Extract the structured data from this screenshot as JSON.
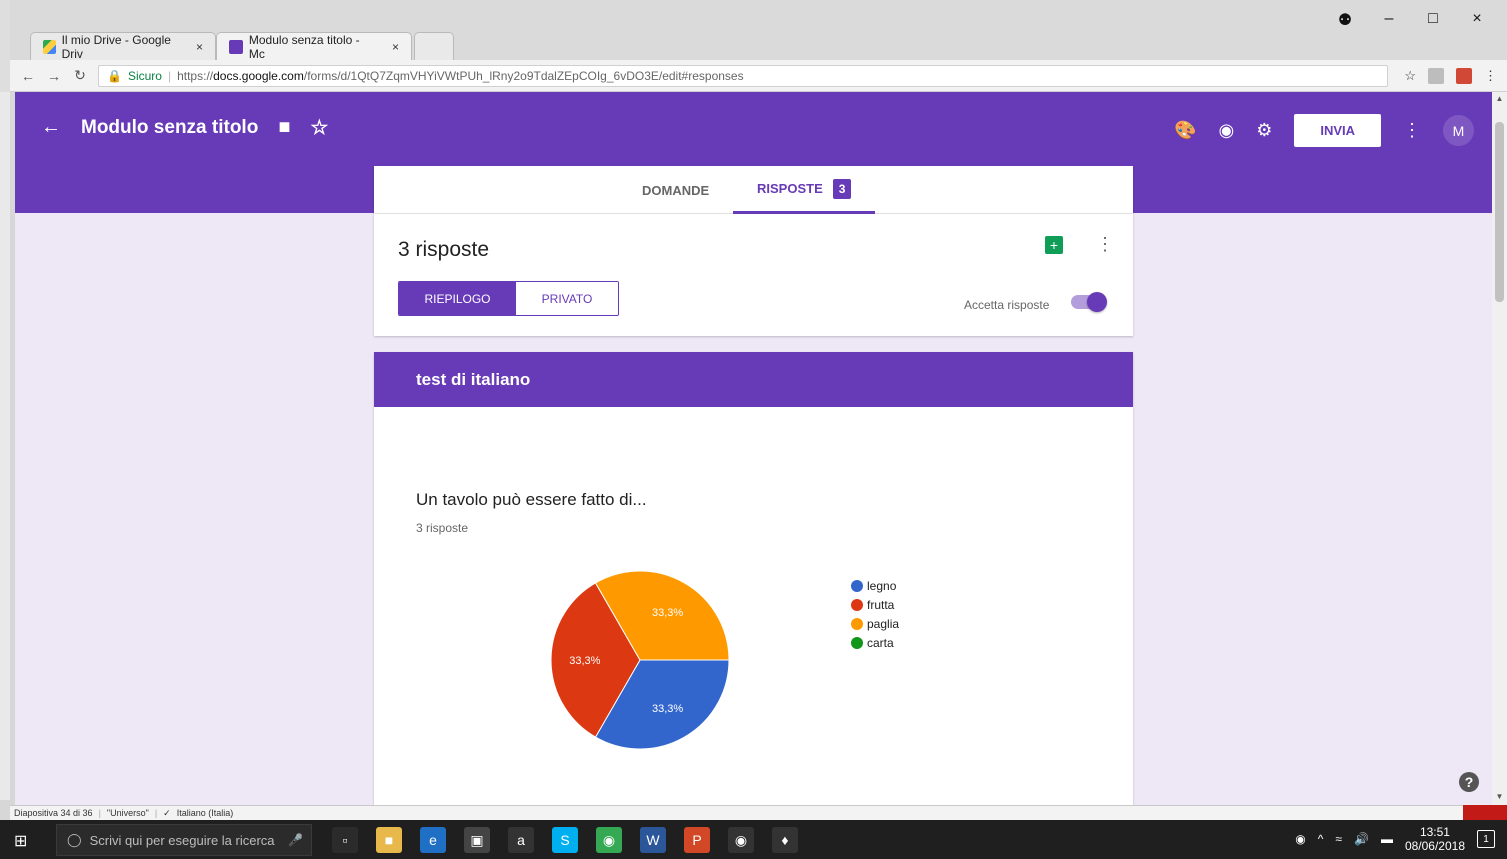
{
  "browser": {
    "tabs": [
      {
        "label": "Il mio Drive - Google Driv",
        "close": "×"
      },
      {
        "label": "Modulo senza titolo - Mc",
        "close": "×"
      }
    ],
    "window_controls": {
      "minimize": "–",
      "maximize": "□",
      "close": "×"
    },
    "omnibox": {
      "secure_label": "Sicuro",
      "url_prefix": "https://",
      "url_host": "docs.google.com",
      "url_path": "/forms/d/1QtQ7ZqmVHYiVWtPUh_lRny2o9TdalZEpCOIg_6vDO3E/edit#responses"
    }
  },
  "header": {
    "title": "Modulo senza titolo",
    "send_label": "INVIA",
    "avatar_initial": "M",
    "colors": {
      "brand": "#673ab7"
    }
  },
  "tabs": {
    "questions_label": "DOMANDE",
    "responses_label": "RISPOSTE",
    "responses_count": "3"
  },
  "responses": {
    "title": "3 risposte",
    "summary_label": "RIEPILOGO",
    "individual_label": "PRIVATO",
    "accept_label": "Accetta risposte",
    "accepting": true
  },
  "section": {
    "title": "test di italiano"
  },
  "question": {
    "title": "Un tavolo può essere fatto di...",
    "count_label": "3 risposte"
  },
  "chart_data": {
    "type": "pie",
    "title": "",
    "slices": [
      {
        "label": "legno",
        "value": 33.3,
        "color": "#3366cc"
      },
      {
        "label": "frutta",
        "value": 33.3,
        "color": "#dc3912"
      },
      {
        "label": "paglia",
        "value": 33.3,
        "color": "#ff9900"
      },
      {
        "label": "carta",
        "value": 0,
        "color": "#109618"
      }
    ],
    "slice_labels": [
      "33,3%",
      "33,3%",
      "33,3%"
    ],
    "legend_position": "right"
  },
  "ppt_status": {
    "slide": "Diapositiva 34 di 36",
    "theme": "\"Universo\"",
    "language": "Italiano (Italia)"
  },
  "taskbar": {
    "search_placeholder": "Scrivi qui per eseguire la ricerca",
    "time": "13:51",
    "date": "08/06/2018"
  }
}
